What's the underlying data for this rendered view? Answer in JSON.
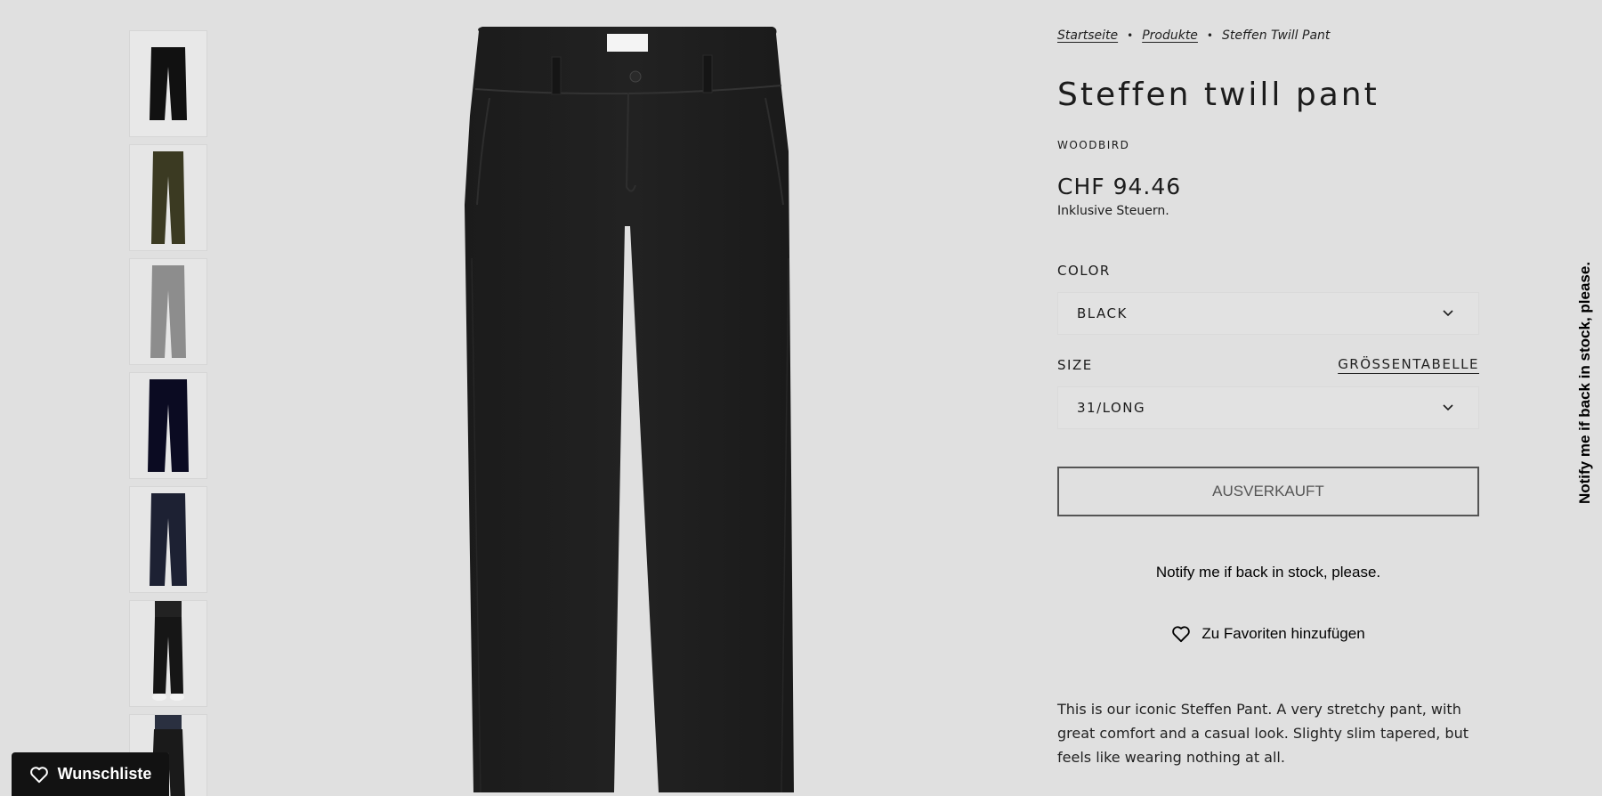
{
  "breadcrumb": {
    "home": "Startseite",
    "products": "Produkte",
    "current": "Steffen Twill Pant",
    "separator": "•"
  },
  "product": {
    "title": "Steffen twill pant",
    "vendor": "WOODBIRD",
    "price": "CHF 94.46",
    "tax_note": "Inklusive Steuern.",
    "description": "This is our iconic Steffen Pant. A very stretchy pant, with great comfort and a casual look. Slighty slim tapered, but feels like wearing nothing at all."
  },
  "options": {
    "color_label": "COLOR",
    "color_value": "BLACK",
    "size_label": "SIZE",
    "size_value": "31/LONG",
    "size_chart_label": "GRÖSSENTABELLE"
  },
  "actions": {
    "sold_out_label": "AUSVERKAUFT",
    "notify_label": "Notify me if back in stock, please.",
    "favorite_label": "Zu Favoriten hinzufügen",
    "side_tab_label": "Notify me if back in stock, please.",
    "wishlist_label": "Wunschliste"
  },
  "thumbnails": [
    {
      "variant": "black",
      "color": "#111111"
    },
    {
      "variant": "olive",
      "color": "#3b3a22"
    },
    {
      "variant": "grey",
      "color": "#8d8d8d"
    },
    {
      "variant": "dark-navy",
      "color": "#0b0b22"
    },
    {
      "variant": "navy",
      "color": "#1d2133"
    },
    {
      "variant": "model-front",
      "color": "#161616"
    },
    {
      "variant": "model-side",
      "color": "#1a1a1a"
    }
  ],
  "colors": {
    "background": "#e0e0e0",
    "text": "#1c1c1c",
    "wishlist_bg": "#121212",
    "sold_out_border": "#555555"
  }
}
